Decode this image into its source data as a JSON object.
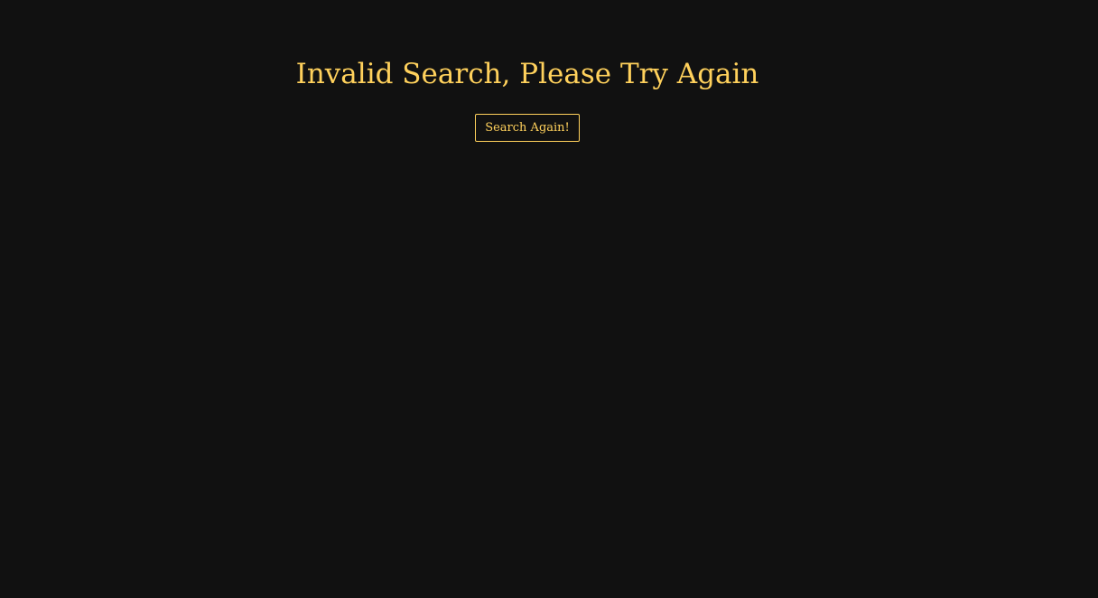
{
  "page": {
    "title": "Invalid Search, Please Try Again",
    "button_label": "Search Again!"
  },
  "colors": {
    "background": "#111111",
    "accent": "#ffd15c"
  }
}
